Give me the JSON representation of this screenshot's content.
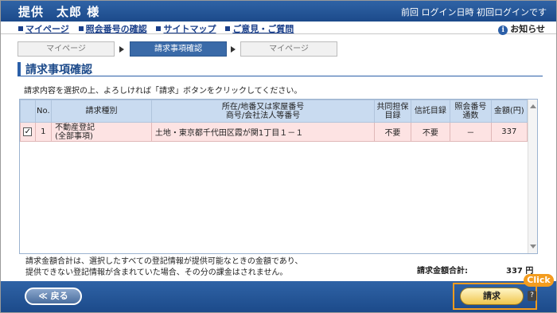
{
  "header": {
    "user_name": "提供　太郎 様",
    "login_info": "前回 ログイン日時 初回ログインです"
  },
  "nav": {
    "links": [
      "マイページ",
      "照会番号の確認",
      "サイトマップ",
      "ご意見・ご質問"
    ],
    "notice": "お知らせ"
  },
  "steps": [
    "マイページ",
    "請求事項確認",
    "マイページ"
  ],
  "page_title": "請求事項確認",
  "instruction": "請求内容を選択の上、よろしければ「請求」ボタンをクリックしてください。",
  "table": {
    "headers": {
      "no": "No.",
      "type": "請求種別",
      "location_line1": "所在/地番又は家屋番号",
      "location_line2": "商号/会社法人等番号",
      "joint_line1": "共同担保",
      "joint_line2": "目録",
      "trust": "信託目録",
      "ref_line1": "照会番号",
      "ref_line2": "通数",
      "amount": "金額(円)"
    },
    "rows": [
      {
        "checked": "✓",
        "no": "1",
        "type_line1": "不動産登記",
        "type_line2": "(全部事項)",
        "location": "土地・東京都千代田区霞が関1丁目１－１",
        "joint": "不要",
        "trust": "不要",
        "ref": "－",
        "amount": "337"
      }
    ]
  },
  "note_line1": "請求金額合計は、選択したすべての登記情報が提供可能なときの金額であり、",
  "note_line2": "提供できない登記情報が含まれていた場合、その分の課金はされません。",
  "total_label": "請求金額合計:",
  "total_value": "337 円",
  "footer": {
    "back_label": "≪ 戻る",
    "request_label": "請求",
    "help_label": "?",
    "click_label": "Click"
  },
  "colors": {
    "header_blue": "#1c4a8a",
    "row_highlight": "#fde3e3",
    "table_header": "#c9dbf0",
    "callout_orange": "#f39c1e"
  }
}
